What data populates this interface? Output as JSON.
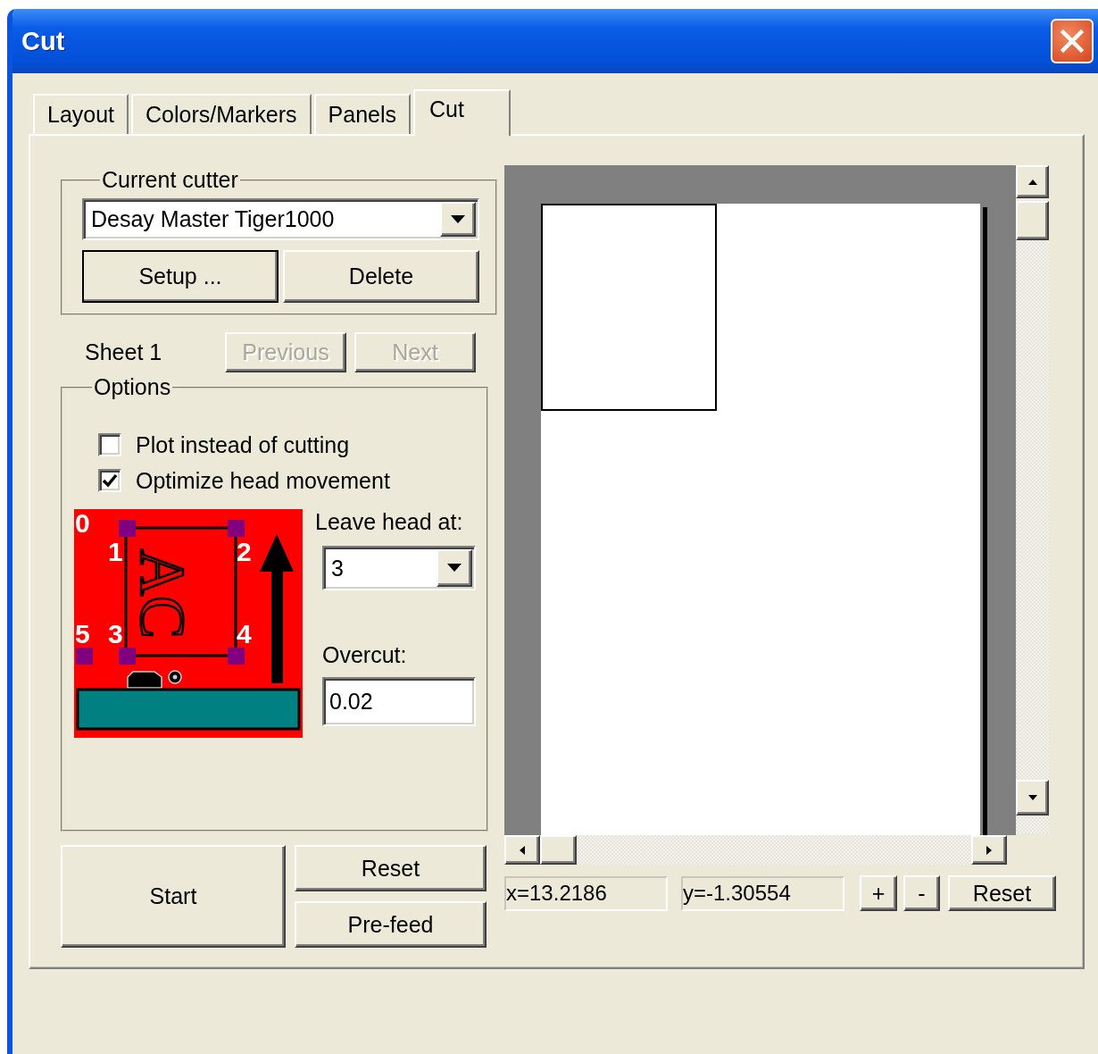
{
  "window": {
    "title": "Cut"
  },
  "tabs": [
    {
      "label": "Layout",
      "selected": false
    },
    {
      "label": "Colors/Markers",
      "selected": false
    },
    {
      "label": "Panels",
      "selected": false
    },
    {
      "label": "Cut",
      "selected": true
    }
  ],
  "current_cutter": {
    "label": "Current cutter",
    "value": "Desay Master Tiger1000",
    "buttons": [
      {
        "label": "Setup ...",
        "default": true
      },
      {
        "label": "Delete",
        "default": false
      }
    ]
  },
  "sheet": {
    "label": "Sheet 1",
    "buttons": [
      {
        "label": "Previous",
        "disabled": true
      },
      {
        "label": "Next",
        "disabled": true
      }
    ]
  },
  "options": {
    "label": "Options",
    "checkboxes": [
      {
        "label": "Plot instead of cutting",
        "checked": false
      },
      {
        "label": "Optimize head movement",
        "checked": true
      }
    ],
    "diagram": {
      "corner_labels": [
        "0",
        "1",
        "2",
        "5",
        "3",
        "4"
      ],
      "sample_text": "AC"
    },
    "leave_head": {
      "label": "Leave head at:",
      "value": "3"
    },
    "overcut": {
      "label": "Overcut:",
      "value": "0.02"
    }
  },
  "actions": [
    {
      "label": "Start"
    },
    {
      "label": "Reset"
    },
    {
      "label": "Pre-feed"
    }
  ],
  "coordinates": {
    "x": "x=13.2186",
    "y": "y=-1.30554"
  },
  "view_buttons": [
    {
      "label": "+"
    },
    {
      "label": "-"
    },
    {
      "label": "Reset"
    }
  ]
}
